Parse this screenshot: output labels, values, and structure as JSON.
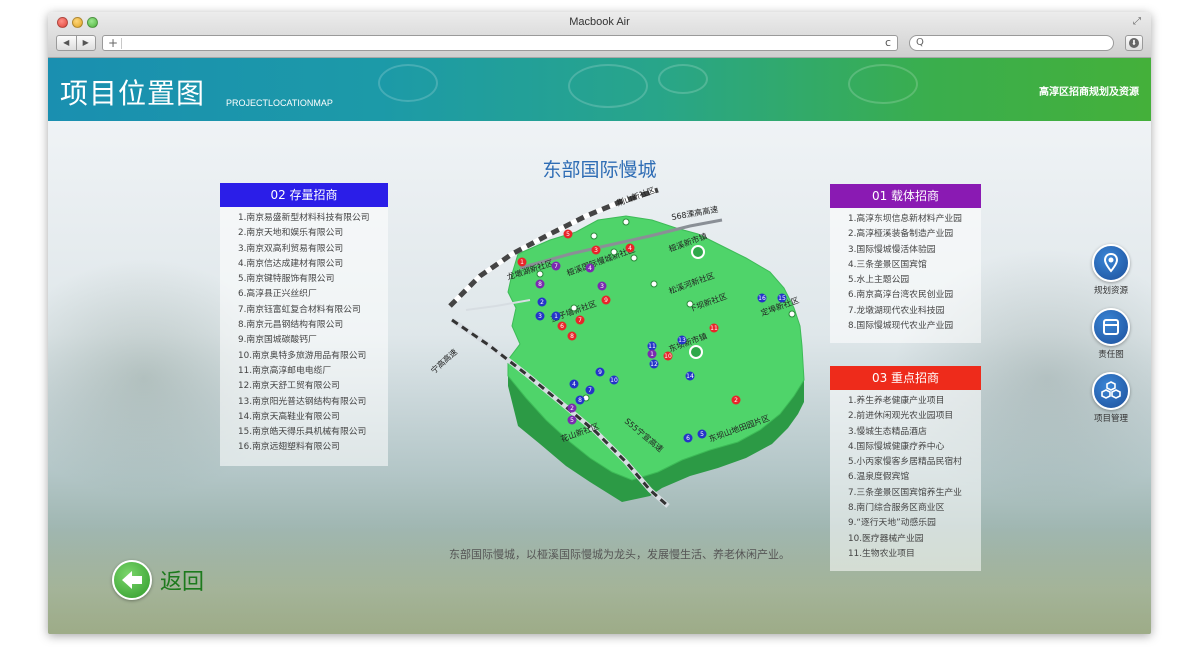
{
  "window": {
    "title": "Macbook Air",
    "nav_back": "◀",
    "nav_forward": "▶",
    "address_plus": "+",
    "reload": "c",
    "search_glyph": "Q",
    "download_glyph": "⬇"
  },
  "banner": {
    "title": "项目位置图",
    "subtitle": "PROJECTLOCATIONMAP",
    "right_text": "高淳区招商规划及资源"
  },
  "section_title": "东部国际慢城",
  "storage_panel": {
    "header": "02 存量招商",
    "items": [
      "1.南京易盛新型材料科技有限公司",
      "2.南京天地和娱乐有限公司",
      "3.南京双高利贸易有限公司",
      "4.南京信达成建材有限公司",
      "5.南京键特服饰有限公司",
      "6.高淳县正兴丝织厂",
      "7.南京钰富虹复合材料有限公司",
      "8.南京元昌钢结构有限公司",
      "9.南京国城碳酸钙厂",
      "10.南京奥特多旅游用品有限公司",
      "11.南京高淳邮电电缆厂",
      "12.南京天舒工贸有限公司",
      "13.南京阳光普达钢结构有限公司",
      "14.南京天高鞋业有限公司",
      "15.南京皓天得乐具机械有限公司",
      "16.南京远翅塑料有限公司"
    ]
  },
  "carrier_panel": {
    "header": "01 载体招商",
    "items": [
      "1.高淳东坝信息新材料产业园",
      "2.高淳桠溪装备制造产业园",
      "3.国际慢城慢活体验园",
      "4.三条垄景区国宾馆",
      "5.水上主题公园",
      "6.南京高淳台湾农民创业园",
      "7.龙墩湖现代农业科技园",
      "8.国际慢城现代农业产业园"
    ]
  },
  "key_panel": {
    "header": "03 重点招商",
    "items": [
      "1.养生养老健康产业项目",
      "2.前进休闲观光农业园项目",
      "3.慢城生态精品酒店",
      "4.国际慢城健康疗养中心",
      "5.小丙家慢客乡居精品民宿村",
      "6.温泉度假宾馆",
      "7.三条垄景区国宾馆养生产业",
      "8.南门综合服务区商业区",
      "9.“逐行天地”动感乐园",
      "10.医疗器械产业园",
      "11.生物农业项目"
    ]
  },
  "map": {
    "roads": [
      "S68溧高高速",
      "宁高高速",
      "S55宁宣高速"
    ],
    "labels": [
      "荆山新社区",
      "龙墩湖新社区",
      "桠溪国际慢城新社区",
      "桠溪新市镇",
      "松溪河新社区",
      "下坝新社区",
      "定埠新社区",
      "垄子墙新社区",
      "东坝新市镇",
      "东坝山地田园片区",
      "花山新社区"
    ],
    "colors": {
      "land": "#4fd46a",
      "land_side": "#2c9a45",
      "red": "#e8252a",
      "blue": "#2434c8",
      "purple": "#7a2bb0"
    },
    "markers": {
      "red": [
        "5",
        "3",
        "4",
        "1",
        "7",
        "9",
        "6",
        "8",
        "10",
        "11",
        "2"
      ],
      "blue": [
        "2",
        "3",
        "1",
        "16",
        "15",
        "11",
        "13",
        "12",
        "9",
        "10",
        "14",
        "7",
        "4",
        "8",
        "6",
        "5"
      ],
      "purple": [
        "7",
        "8",
        "4",
        "3",
        "1",
        "2",
        "5"
      ]
    }
  },
  "caption": "东部国际慢城，以桠溪国际慢城为龙头，发展慢生活、养老休闲产业。",
  "back": {
    "label": "返回"
  },
  "side_buttons": [
    {
      "label": "规划资源"
    },
    {
      "label": "责任图"
    },
    {
      "label": "项目管理"
    }
  ]
}
